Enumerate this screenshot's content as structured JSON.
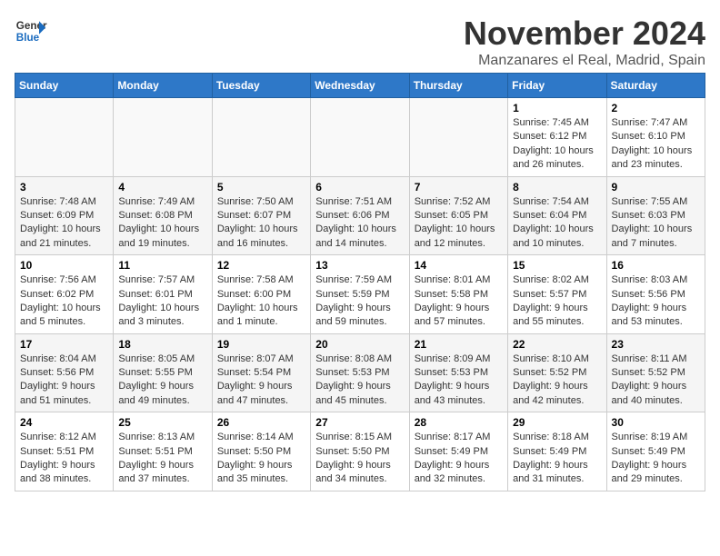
{
  "logo": {
    "line1": "General",
    "line2": "Blue"
  },
  "title": "November 2024",
  "location": "Manzanares el Real, Madrid, Spain",
  "weekdays": [
    "Sunday",
    "Monday",
    "Tuesday",
    "Wednesday",
    "Thursday",
    "Friday",
    "Saturday"
  ],
  "weeks": [
    [
      {
        "day": "",
        "content": ""
      },
      {
        "day": "",
        "content": ""
      },
      {
        "day": "",
        "content": ""
      },
      {
        "day": "",
        "content": ""
      },
      {
        "day": "",
        "content": ""
      },
      {
        "day": "1",
        "content": "Sunrise: 7:45 AM\nSunset: 6:12 PM\nDaylight: 10 hours and 26 minutes."
      },
      {
        "day": "2",
        "content": "Sunrise: 7:47 AM\nSunset: 6:10 PM\nDaylight: 10 hours and 23 minutes."
      }
    ],
    [
      {
        "day": "3",
        "content": "Sunrise: 7:48 AM\nSunset: 6:09 PM\nDaylight: 10 hours and 21 minutes."
      },
      {
        "day": "4",
        "content": "Sunrise: 7:49 AM\nSunset: 6:08 PM\nDaylight: 10 hours and 19 minutes."
      },
      {
        "day": "5",
        "content": "Sunrise: 7:50 AM\nSunset: 6:07 PM\nDaylight: 10 hours and 16 minutes."
      },
      {
        "day": "6",
        "content": "Sunrise: 7:51 AM\nSunset: 6:06 PM\nDaylight: 10 hours and 14 minutes."
      },
      {
        "day": "7",
        "content": "Sunrise: 7:52 AM\nSunset: 6:05 PM\nDaylight: 10 hours and 12 minutes."
      },
      {
        "day": "8",
        "content": "Sunrise: 7:54 AM\nSunset: 6:04 PM\nDaylight: 10 hours and 10 minutes."
      },
      {
        "day": "9",
        "content": "Sunrise: 7:55 AM\nSunset: 6:03 PM\nDaylight: 10 hours and 7 minutes."
      }
    ],
    [
      {
        "day": "10",
        "content": "Sunrise: 7:56 AM\nSunset: 6:02 PM\nDaylight: 10 hours and 5 minutes."
      },
      {
        "day": "11",
        "content": "Sunrise: 7:57 AM\nSunset: 6:01 PM\nDaylight: 10 hours and 3 minutes."
      },
      {
        "day": "12",
        "content": "Sunrise: 7:58 AM\nSunset: 6:00 PM\nDaylight: 10 hours and 1 minute."
      },
      {
        "day": "13",
        "content": "Sunrise: 7:59 AM\nSunset: 5:59 PM\nDaylight: 9 hours and 59 minutes."
      },
      {
        "day": "14",
        "content": "Sunrise: 8:01 AM\nSunset: 5:58 PM\nDaylight: 9 hours and 57 minutes."
      },
      {
        "day": "15",
        "content": "Sunrise: 8:02 AM\nSunset: 5:57 PM\nDaylight: 9 hours and 55 minutes."
      },
      {
        "day": "16",
        "content": "Sunrise: 8:03 AM\nSunset: 5:56 PM\nDaylight: 9 hours and 53 minutes."
      }
    ],
    [
      {
        "day": "17",
        "content": "Sunrise: 8:04 AM\nSunset: 5:56 PM\nDaylight: 9 hours and 51 minutes."
      },
      {
        "day": "18",
        "content": "Sunrise: 8:05 AM\nSunset: 5:55 PM\nDaylight: 9 hours and 49 minutes."
      },
      {
        "day": "19",
        "content": "Sunrise: 8:07 AM\nSunset: 5:54 PM\nDaylight: 9 hours and 47 minutes."
      },
      {
        "day": "20",
        "content": "Sunrise: 8:08 AM\nSunset: 5:53 PM\nDaylight: 9 hours and 45 minutes."
      },
      {
        "day": "21",
        "content": "Sunrise: 8:09 AM\nSunset: 5:53 PM\nDaylight: 9 hours and 43 minutes."
      },
      {
        "day": "22",
        "content": "Sunrise: 8:10 AM\nSunset: 5:52 PM\nDaylight: 9 hours and 42 minutes."
      },
      {
        "day": "23",
        "content": "Sunrise: 8:11 AM\nSunset: 5:52 PM\nDaylight: 9 hours and 40 minutes."
      }
    ],
    [
      {
        "day": "24",
        "content": "Sunrise: 8:12 AM\nSunset: 5:51 PM\nDaylight: 9 hours and 38 minutes."
      },
      {
        "day": "25",
        "content": "Sunrise: 8:13 AM\nSunset: 5:51 PM\nDaylight: 9 hours and 37 minutes."
      },
      {
        "day": "26",
        "content": "Sunrise: 8:14 AM\nSunset: 5:50 PM\nDaylight: 9 hours and 35 minutes."
      },
      {
        "day": "27",
        "content": "Sunrise: 8:15 AM\nSunset: 5:50 PM\nDaylight: 9 hours and 34 minutes."
      },
      {
        "day": "28",
        "content": "Sunrise: 8:17 AM\nSunset: 5:49 PM\nDaylight: 9 hours and 32 minutes."
      },
      {
        "day": "29",
        "content": "Sunrise: 8:18 AM\nSunset: 5:49 PM\nDaylight: 9 hours and 31 minutes."
      },
      {
        "day": "30",
        "content": "Sunrise: 8:19 AM\nSunset: 5:49 PM\nDaylight: 9 hours and 29 minutes."
      }
    ]
  ]
}
